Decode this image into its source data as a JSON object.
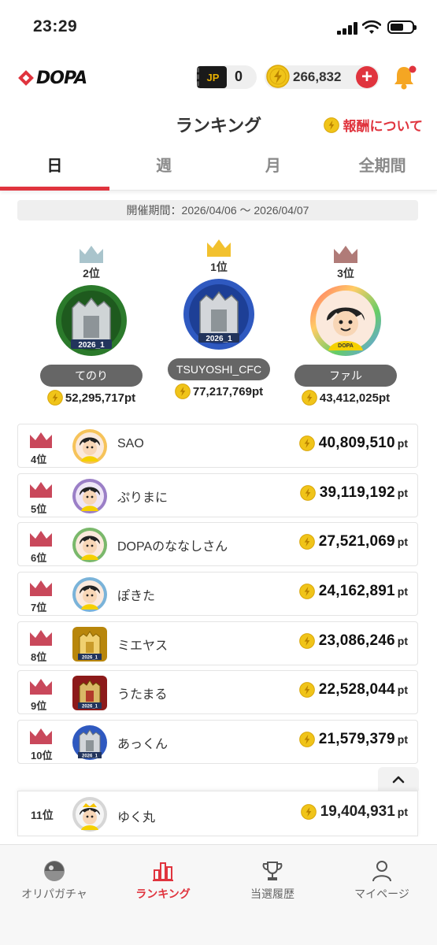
{
  "status_bar": {
    "time": "23:29"
  },
  "header": {
    "logo": "DOPA",
    "ticket_label": "JP",
    "ticket_count": "0",
    "coin_balance": "266,832",
    "add_icon": "plus-icon",
    "bell_icon": "bell-icon"
  },
  "title": "ランキング",
  "reward_link": "報酬について",
  "tabs": [
    {
      "label": "日",
      "active": true
    },
    {
      "label": "週",
      "active": false
    },
    {
      "label": "月",
      "active": false
    },
    {
      "label": "全期間",
      "active": false
    }
  ],
  "period": "開催期間：2026/04/06 〜 2026/04/07",
  "podium": {
    "first": {
      "rank": "1位",
      "name": "TSUYOSHI_CFC",
      "points": "77,217,769pt",
      "crown_color": "#f2c12e",
      "badge": "2026_1"
    },
    "second": {
      "rank": "2位",
      "name": "てのり",
      "points": "52,295,717pt",
      "crown_color": "#a9c4cc",
      "badge": "2026_1"
    },
    "third": {
      "rank": "3位",
      "name": "ファル",
      "points": "43,412,025pt",
      "crown_color": "#b07b78",
      "avatar_label": "DOPA"
    }
  },
  "ranking": [
    {
      "rank": "4位",
      "name": "SAO",
      "points": "40,809,510",
      "unit": "pt"
    },
    {
      "rank": "5位",
      "name": "ぷりまに",
      "points": "39,119,192",
      "unit": "pt"
    },
    {
      "rank": "6位",
      "name": "DOPAのななしさん",
      "points": "27,521,069",
      "unit": "pt"
    },
    {
      "rank": "7位",
      "name": "ぽきた",
      "points": "24,162,891",
      "unit": "pt"
    },
    {
      "rank": "8位",
      "name": "ミエヤス",
      "points": "23,086,246",
      "unit": "pt",
      "badge": "2026_1"
    },
    {
      "rank": "9位",
      "name": "うたまる",
      "points": "22,528,044",
      "unit": "pt",
      "badge": "2026_1"
    },
    {
      "rank": "10位",
      "name": "あっくん",
      "points": "21,579,379",
      "unit": "pt",
      "badge": "2026_1"
    }
  ],
  "my_rank": {
    "rank": "11位",
    "name": "ゆく丸",
    "points": "19,404,931",
    "unit": "pt"
  },
  "colors": {
    "accent": "#e0343e",
    "coin": "#f0c419",
    "list_crown": "#c9485b"
  },
  "bottom_nav": [
    {
      "label": "オリパガチャ",
      "icon": "gacha-ball-icon",
      "active": false
    },
    {
      "label": "ランキング",
      "icon": "bar-chart-icon",
      "active": true
    },
    {
      "label": "当選履歴",
      "icon": "trophy-icon",
      "active": false
    },
    {
      "label": "マイページ",
      "icon": "person-icon",
      "active": false
    }
  ]
}
